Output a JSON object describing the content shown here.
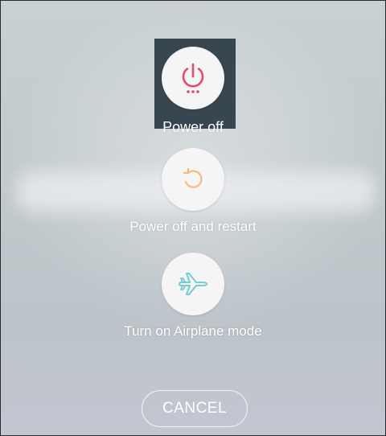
{
  "power_menu": {
    "items": [
      {
        "label": "Power off",
        "icon": "power-icon",
        "icon_color": "#e64a67",
        "selected": true
      },
      {
        "label": "Power off and restart",
        "icon": "restart-icon",
        "icon_color": "#f0be7a",
        "selected": false
      },
      {
        "label": "Turn on Airplane mode",
        "icon": "airplane-icon",
        "icon_color": "#76cbd3",
        "selected": false
      }
    ],
    "cancel_label": "CANCEL"
  },
  "colors": {
    "highlight": "#38464f",
    "circle": "#f5f5f5",
    "text": "#ffffff"
  }
}
